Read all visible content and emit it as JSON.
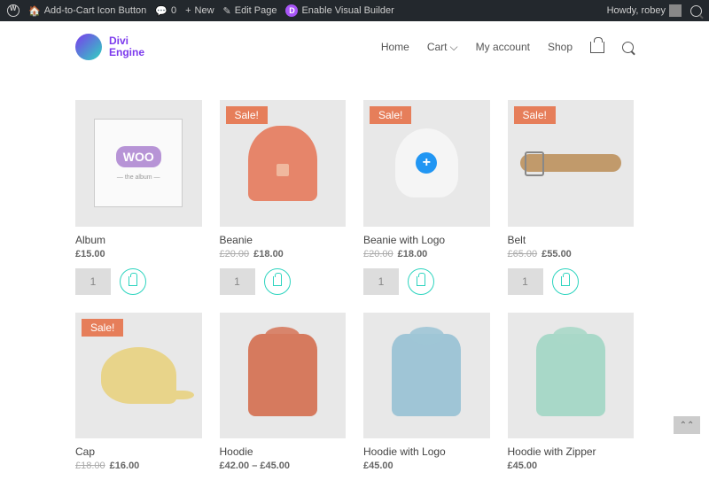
{
  "adminBar": {
    "site": "Add-to-Cart Icon Button",
    "comments": "0",
    "new": "New",
    "edit": "Edit Page",
    "visualBuilder": "Enable Visual Builder",
    "howdy": "Howdy, robey"
  },
  "brand": {
    "line1": "Divi",
    "line2": "Engine"
  },
  "nav": {
    "home": "Home",
    "cart": "Cart",
    "account": "My account",
    "shop": "Shop"
  },
  "saleLabel": "Sale!",
  "qtyDefault": "1",
  "products": [
    {
      "title": "Album",
      "old": "",
      "price": "£15.00",
      "sale": false
    },
    {
      "title": "Beanie",
      "old": "£20.00",
      "price": "£18.00",
      "sale": true
    },
    {
      "title": "Beanie with Logo",
      "old": "£20.00",
      "price": "£18.00",
      "sale": true
    },
    {
      "title": "Belt",
      "old": "£65.00",
      "price": "£55.00",
      "sale": true
    },
    {
      "title": "Cap",
      "old": "£18.00",
      "price": "£16.00",
      "sale": true
    },
    {
      "title": "Hoodie",
      "old": "",
      "price": "£42.00 – £45.00",
      "sale": false
    },
    {
      "title": "Hoodie with Logo",
      "old": "",
      "price": "£45.00",
      "sale": false
    },
    {
      "title": "Hoodie with Zipper",
      "old": "",
      "price": "£45.00",
      "sale": false
    }
  ]
}
